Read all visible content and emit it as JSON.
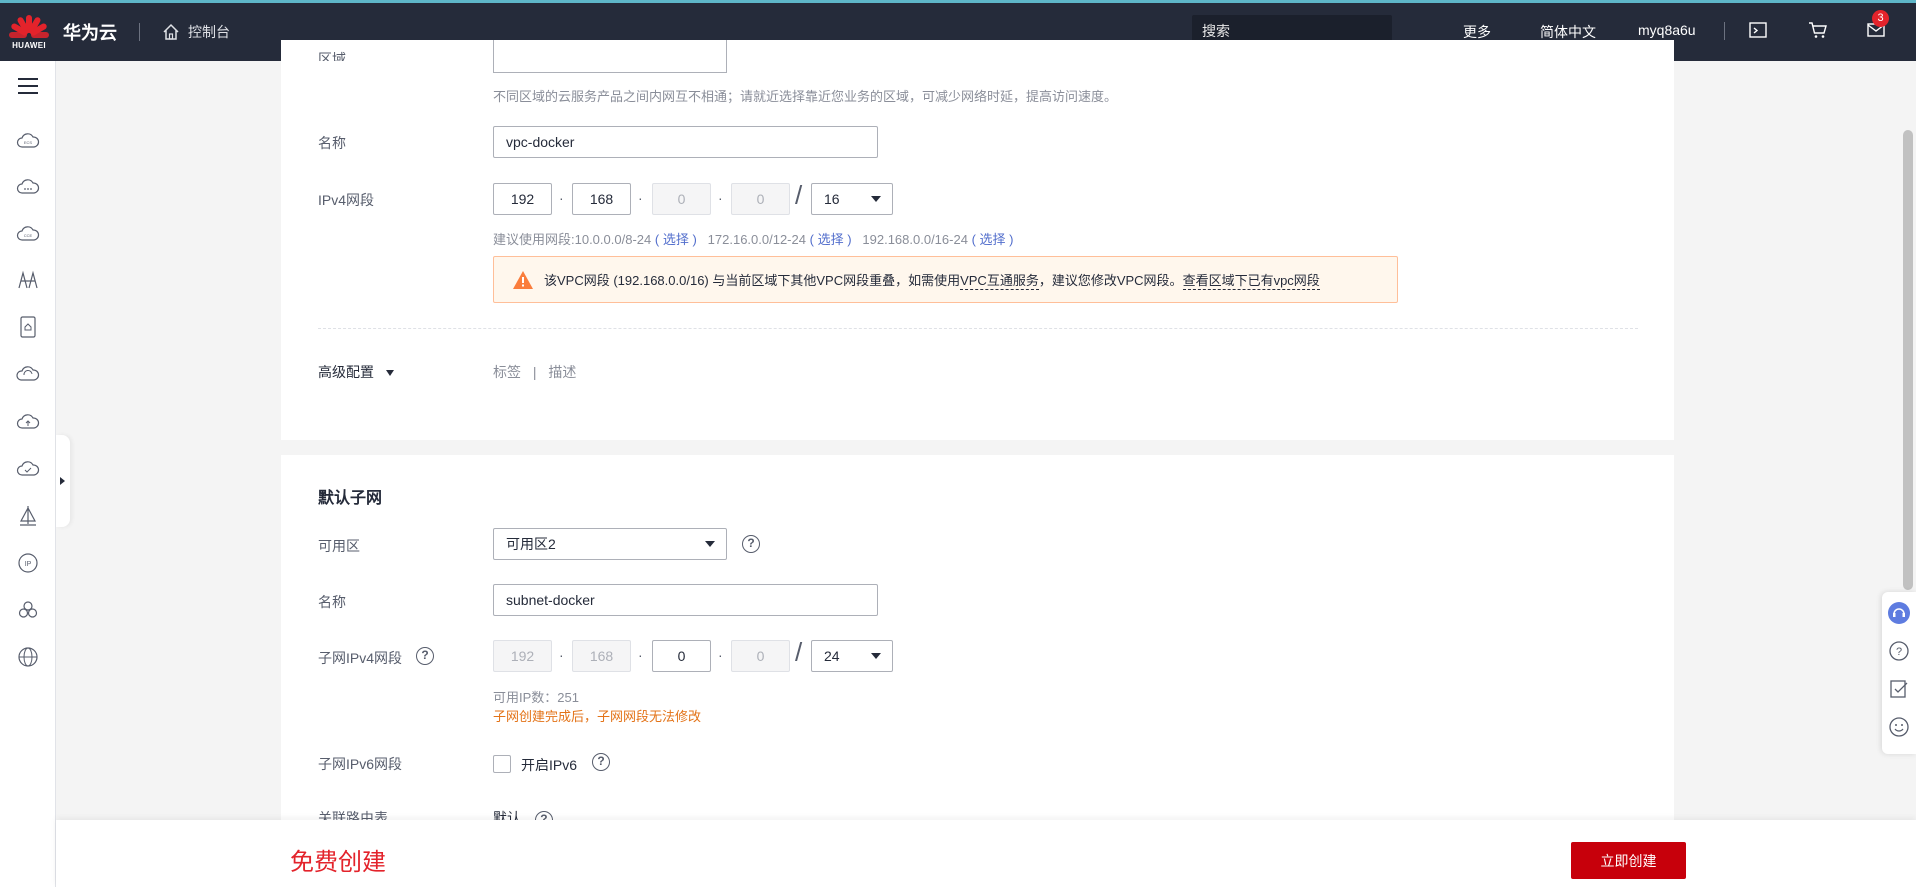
{
  "topbar": {
    "brand": "HUAWEI",
    "cloud_name": "华为云",
    "console": "控制台",
    "search_placeholder": "搜索",
    "more": "更多",
    "language": "简体中文",
    "username": "myq8a6u",
    "notification_count": "3"
  },
  "vpc_section": {
    "region_label": "区域",
    "region_hint": "不同区域的云服务产品之间内网互不相通；请就近选择靠近您业务的区域，可减少网络时延，提高访问速度。",
    "name_label": "名称",
    "name_value": "vpc-docker",
    "ipv4_label": "IPv4网段",
    "ip1": "192",
    "ip2": "168",
    "ip3": "0",
    "ip4": "0",
    "mask": "16",
    "suggest_prefix": "建议使用网段:10.0.0.0/8-24",
    "suggest_2": "172.16.0.0/12-24",
    "suggest_3": "192.168.0.0/16-24",
    "select_open": "(",
    "select_text": "选择",
    "select_close": ")",
    "warn_text_1": "该VPC网段 (192.168.0.0/16) 与当前区域下其他VPC网段重叠，如需使用",
    "warn_link_1": "VPC互通服务",
    "warn_text_2": "，建议您修改VPC网段。",
    "warn_link_2": "查看区域下已有vpc网段",
    "advanced_label": "高级配置",
    "tag_link": "标签",
    "desc_link": "描述"
  },
  "subnet_section": {
    "title": "默认子网",
    "az_label": "可用区",
    "az_value": "可用区2",
    "name_label": "名称",
    "name_value": "subnet-docker",
    "ipv4_label": "子网IPv4网段",
    "ip1": "192",
    "ip2": "168",
    "ip3": "0",
    "ip4": "0",
    "mask": "24",
    "available_ip": "可用IP数：251",
    "warning": "子网创建完成后，子网网段无法修改",
    "ipv6_label": "子网IPv6网段",
    "ipv6_checkbox": "开启IPv6",
    "route_label": "关联路由表",
    "route_value": "默认"
  },
  "bottombar": {
    "price": "免费创建",
    "create_button": "立即创建"
  },
  "colors": {
    "topbar": "#252b3a",
    "accent_red": "#c7000b",
    "link": "#526ecc",
    "warning_orange": "#e37318"
  }
}
